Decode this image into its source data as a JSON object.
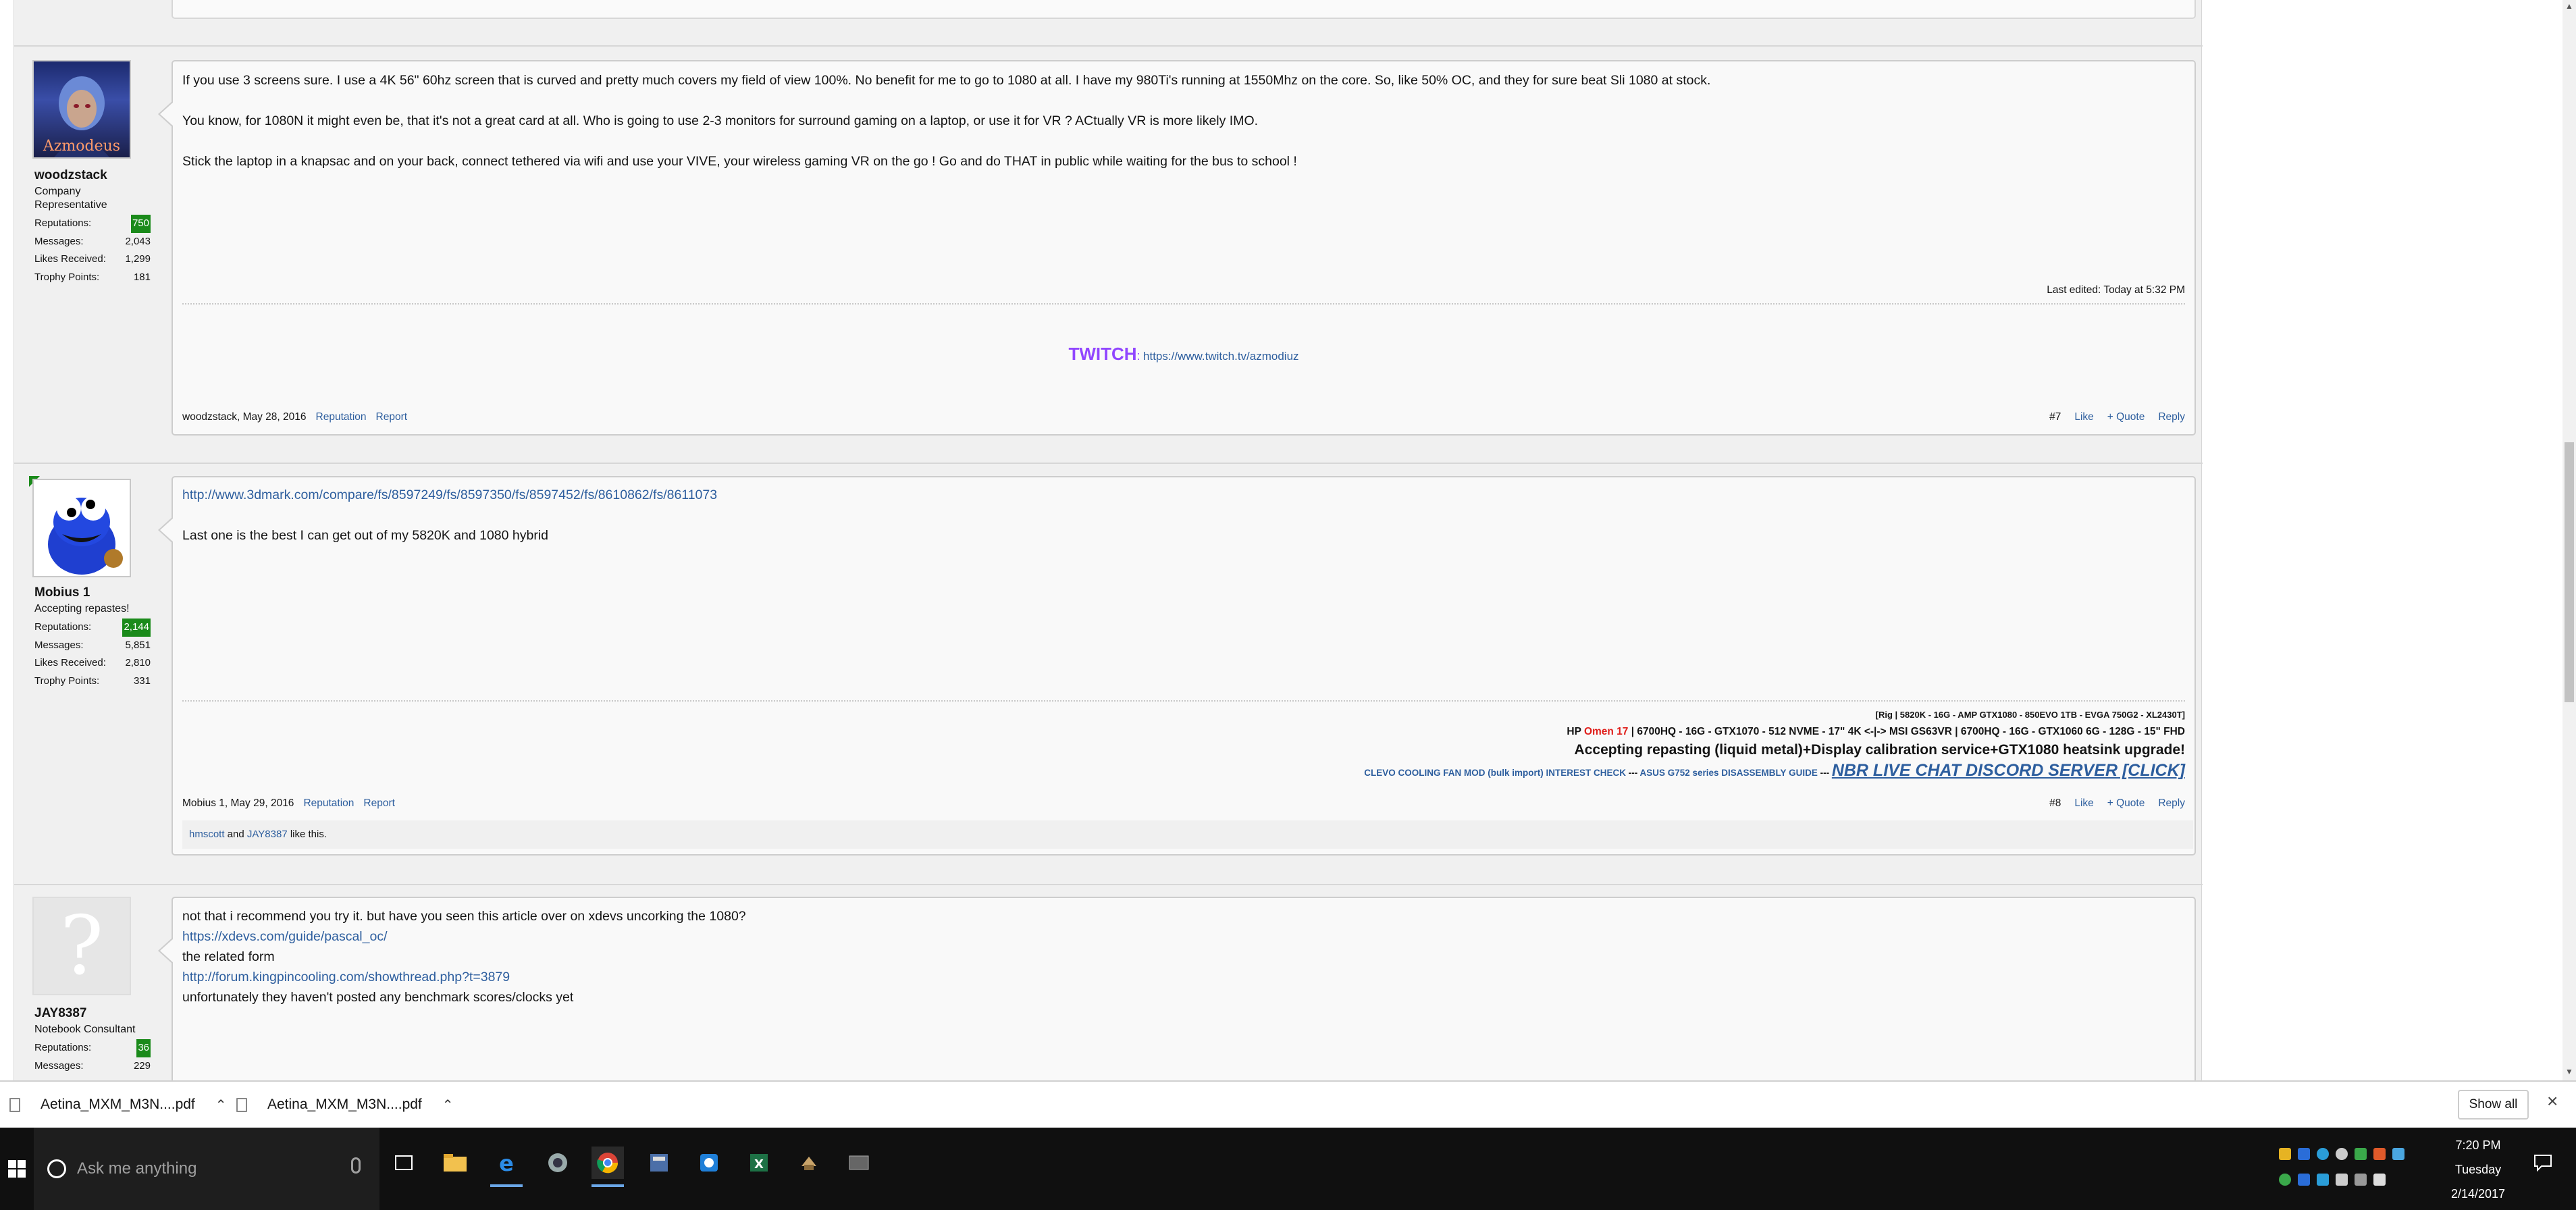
{
  "posts": [
    {
      "user": {
        "name": "woodzstack",
        "title_line1": "Company",
        "title_line2": "Representative",
        "avatar_text": "Azmodeus",
        "stats": [
          {
            "label": "Reputations:",
            "value": "750"
          },
          {
            "label": "Messages:",
            "value": "2,043"
          },
          {
            "label": "Likes Received:",
            "value": "1,299"
          },
          {
            "label": "Trophy Points:",
            "value": "181"
          }
        ]
      },
      "paragraphs": [
        "If you use 3 screens sure. I use a 4K 56\" 60hz screen that is curved and pretty much covers my field of view 100%. No benefit for me to go to 1080 at all. I have my 980Ti's running at 1550Mhz on the core. So, like 50% OC, and they for sure beat Sli 1080 at stock.",
        "You know, for 1080N it might even be, that it's not a great card at all. Who is going to use 2-3 monitors for surround gaming on a laptop, or use it for VR ? ACtually VR is more likely IMO.",
        "Stick the laptop in a knapsac and on your back, connect tethered via wifi and use your VIVE, your wireless gaming VR on the go ! Go and do THAT in public while waiting for the bus to school !"
      ],
      "last_edited": "Last edited: Today at 5:32 PM",
      "sig_twitch_label": "TWITCH",
      "sig_twitch_colon": ":",
      "sig_twitch_url": "https://www.twitch.tv/azmodiuz",
      "meta": {
        "author_date": "woodzstack, May 28, 2016",
        "reputation": "Reputation",
        "report": "Report"
      },
      "actions": {
        "num": "#7",
        "like": "Like",
        "quote": "+ Quote",
        "reply": "Reply"
      }
    },
    {
      "user": {
        "name": "Mobius 1",
        "title_line1": "Accepting repastes!",
        "stats": [
          {
            "label": "Reputations:",
            "value": "2,144"
          },
          {
            "label": "Messages:",
            "value": "5,851"
          },
          {
            "label": "Likes Received:",
            "value": "2,810"
          },
          {
            "label": "Trophy Points:",
            "value": "331"
          }
        ]
      },
      "link": "http://www.3dmark.com/compare/fs/8597249/fs/8597350/fs/8597452/fs/8610862/fs/8611073",
      "text": "Last one is the best I can get out of my 5820K and 1080 hybrid",
      "sig": {
        "rig": "[Rig | 5820K - 16G - AMP GTX1080 - 850EVO 1TB - EVGA 750G2 - XL2430T]",
        "hp": "HP",
        "omen": "Omen 17",
        "hp_rest": " | 6700HQ - 16G - GTX1070 - 512 NVME - 17\" 4K <-|-> MSI GS63VR | 6700HQ - 16G - GTX1060 6G - 128G - 15\" FHD",
        "accepting": "Accepting repasting (liquid metal)+Display calibration service+GTX1080 heatsink upgrade!",
        "clevo": "CLEVO COOLING FAN MOD (bulk import) INTEREST CHECK",
        "dash1": " --- ",
        "asus": "ASUS G752 series DISASSEMBLY GUIDE",
        "dash2": " --- ",
        "nbr": "NBR LIVE CHAT DISCORD SERVER [CLICK]"
      },
      "meta": {
        "author_date": "Mobius 1, May 29, 2016",
        "reputation": "Reputation",
        "report": "Report"
      },
      "actions": {
        "num": "#8",
        "like": "Like",
        "quote": "+ Quote",
        "reply": "Reply"
      },
      "likes": {
        "user1": "hmscott",
        "and": " and ",
        "user2": "JAY8387",
        "suffix": " like this."
      }
    },
    {
      "user": {
        "name": "JAY8387",
        "title_line1": "Notebook Consultant",
        "stats": [
          {
            "label": "Reputations:",
            "value": "36"
          },
          {
            "label": "Messages:",
            "value": "229"
          }
        ]
      },
      "lines": [
        {
          "text": "not that i recommend you try it. but have you seen this article over on xdevs uncorking the 1080?",
          "link": false
        },
        {
          "text": "https://xdevs.com/guide/pascal_oc/",
          "link": true
        },
        {
          "text": "the related form",
          "link": false
        },
        {
          "text": "http://forum.kingpincooling.com/showthread.php?t=3879",
          "link": true
        },
        {
          "text": "unfortunately they haven't posted any benchmark scores/clocks yet",
          "link": false
        }
      ]
    }
  ],
  "downloads": {
    "items": [
      "Aetina_MXM_M3N....pdf",
      "Aetina_MXM_M3N....pdf"
    ],
    "show_all": "Show all"
  },
  "taskbar": {
    "search_placeholder": "Ask me anything",
    "time": "7:20 PM",
    "day": "Tuesday",
    "date": "2/14/2017"
  },
  "colors": {
    "link": "#2d5e9e",
    "twitch": "#9146ff",
    "omen": "#e0201c",
    "rep_badge": "#1a8a1a"
  }
}
